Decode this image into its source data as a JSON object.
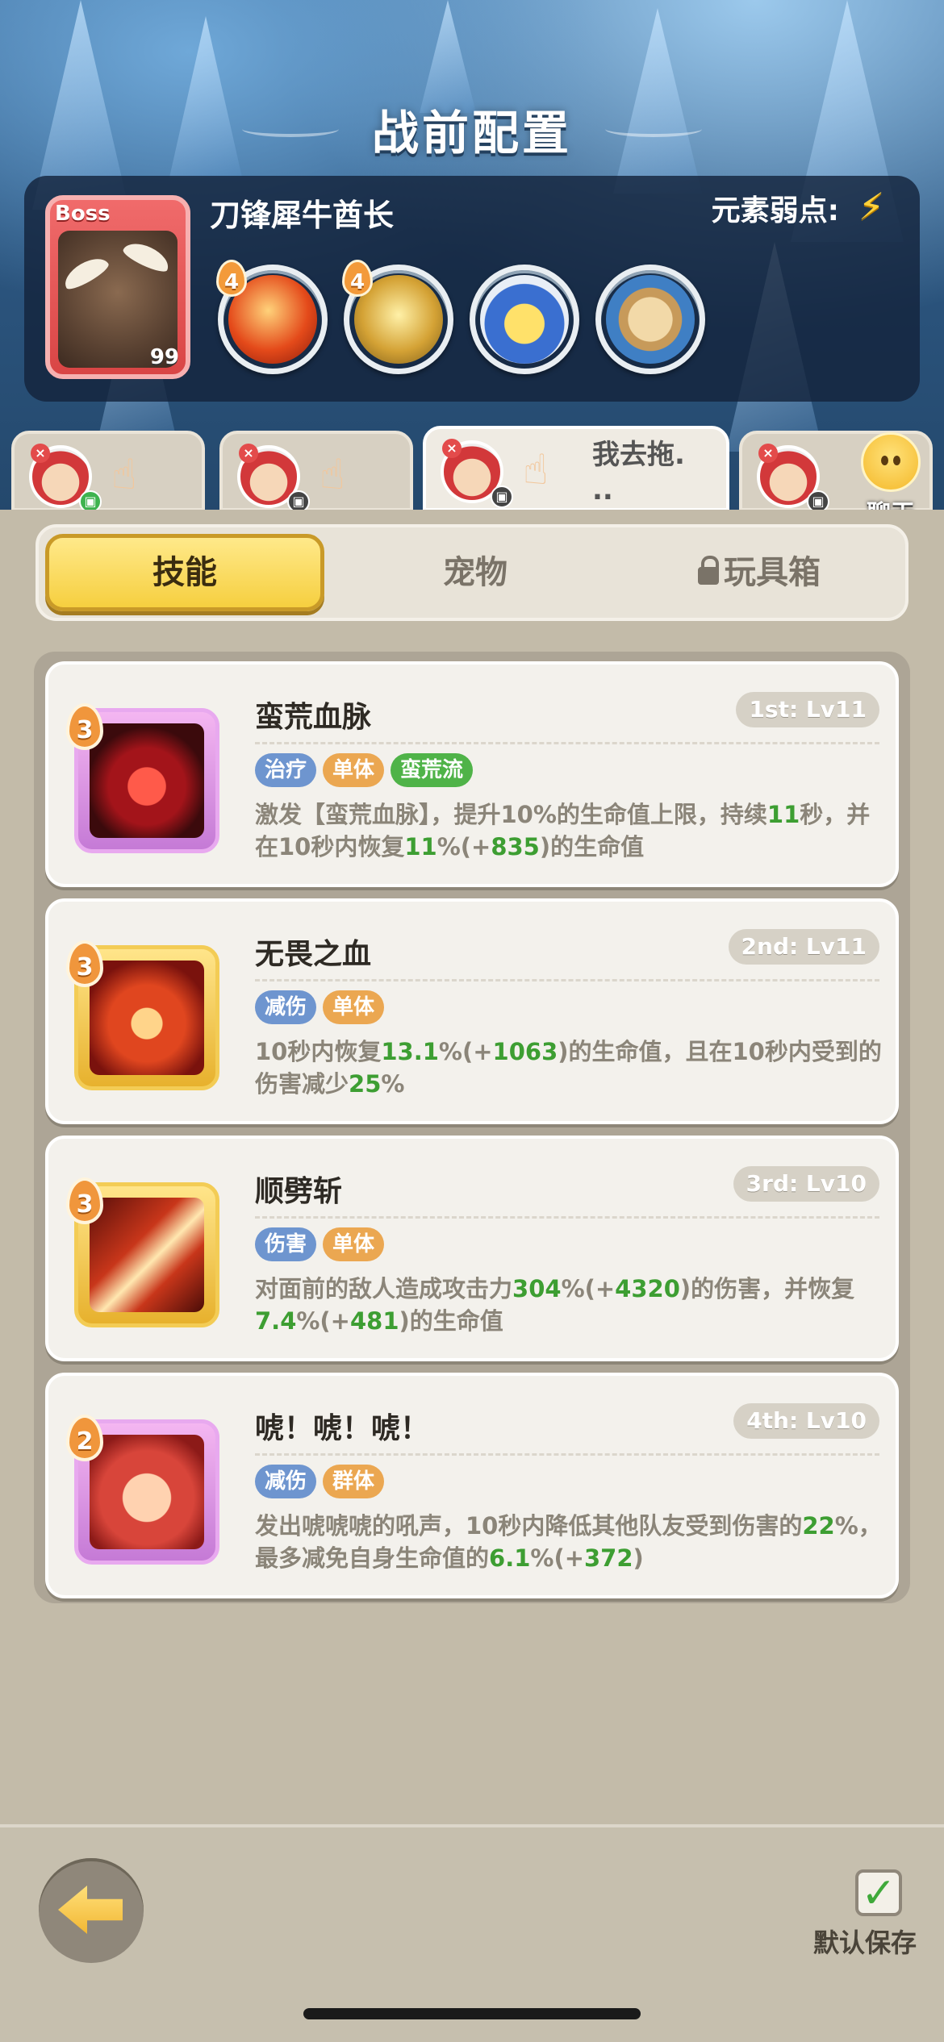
{
  "header": {
    "title": "战前配置"
  },
  "boss": {
    "tag": "Boss",
    "level": "99",
    "name": "刀锋犀牛酋长",
    "weakness_label": "元素弱点:",
    "weakness_icon": "lightning-icon",
    "skills": [
      {
        "icon": "flame-claw-icon",
        "level": "4"
      },
      {
        "icon": "golden-burst-icon",
        "level": "4"
      },
      {
        "icon": "beast-face-icon",
        "level": ""
      },
      {
        "icon": "shield-shard-icon",
        "level": ""
      }
    ]
  },
  "team_tabs": [
    {
      "message": "",
      "badge": "controller-green"
    },
    {
      "message": "",
      "badge": "controller"
    },
    {
      "message": "我去拖.\n..",
      "badge": "controller"
    },
    {
      "message": "",
      "badge": "controller"
    }
  ],
  "chat": {
    "label": "聊天"
  },
  "tabs": [
    {
      "label": "技能",
      "active": true
    },
    {
      "label": "宠物",
      "active": false
    },
    {
      "label": "玩具箱",
      "active": false,
      "locked": true
    }
  ],
  "skills": [
    {
      "rank": "3",
      "name": "蛮荒血脉",
      "slot": "1st: Lv11",
      "frame": "purple",
      "tags": [
        {
          "text": "治疗",
          "color": "blue"
        },
        {
          "text": "单体",
          "color": "orange"
        },
        {
          "text": "蛮荒流",
          "color": "green"
        }
      ],
      "desc_parts": [
        "激发【蛮荒血脉】，提升10%的生命值上限，持续",
        "11",
        "秒，并在10秒内恢复",
        "11",
        "%(+",
        "835",
        ")的生命值"
      ]
    },
    {
      "rank": "3",
      "name": "无畏之血",
      "slot": "2nd: Lv11",
      "frame": "gold",
      "tags": [
        {
          "text": "减伤",
          "color": "blue"
        },
        {
          "text": "单体",
          "color": "orange"
        }
      ],
      "desc_parts": [
        "10秒内恢复",
        "13.1",
        "%(+",
        "1063",
        ")的生命值，且在10秒内受到的伤害减少",
        "25",
        "%"
      ]
    },
    {
      "rank": "3",
      "name": "顺劈斩",
      "slot": "3rd: Lv10",
      "frame": "gold",
      "tags": [
        {
          "text": "伤害",
          "color": "blue"
        },
        {
          "text": "单体",
          "color": "orange"
        }
      ],
      "desc_parts": [
        "对面前的敌人造成攻击力",
        "304",
        "%(+",
        "4320",
        ")的伤害，并恢复",
        "7.4",
        "%(+",
        "481",
        ")的生命值"
      ]
    },
    {
      "rank": "2",
      "name": "唬！唬！唬！",
      "slot": "4th: Lv10",
      "frame": "purple",
      "tags": [
        {
          "text": "减伤",
          "color": "blue"
        },
        {
          "text": "群体",
          "color": "orange"
        }
      ],
      "desc_parts": [
        "发出唬唬唬的吼声，10秒内降低其他队友受到伤害的",
        "22",
        "%，最多减免自身生命值的",
        "6.1",
        "%(+",
        "372",
        ")"
      ]
    }
  ],
  "footer": {
    "save_label": "默认保存",
    "save_checked": true
  }
}
